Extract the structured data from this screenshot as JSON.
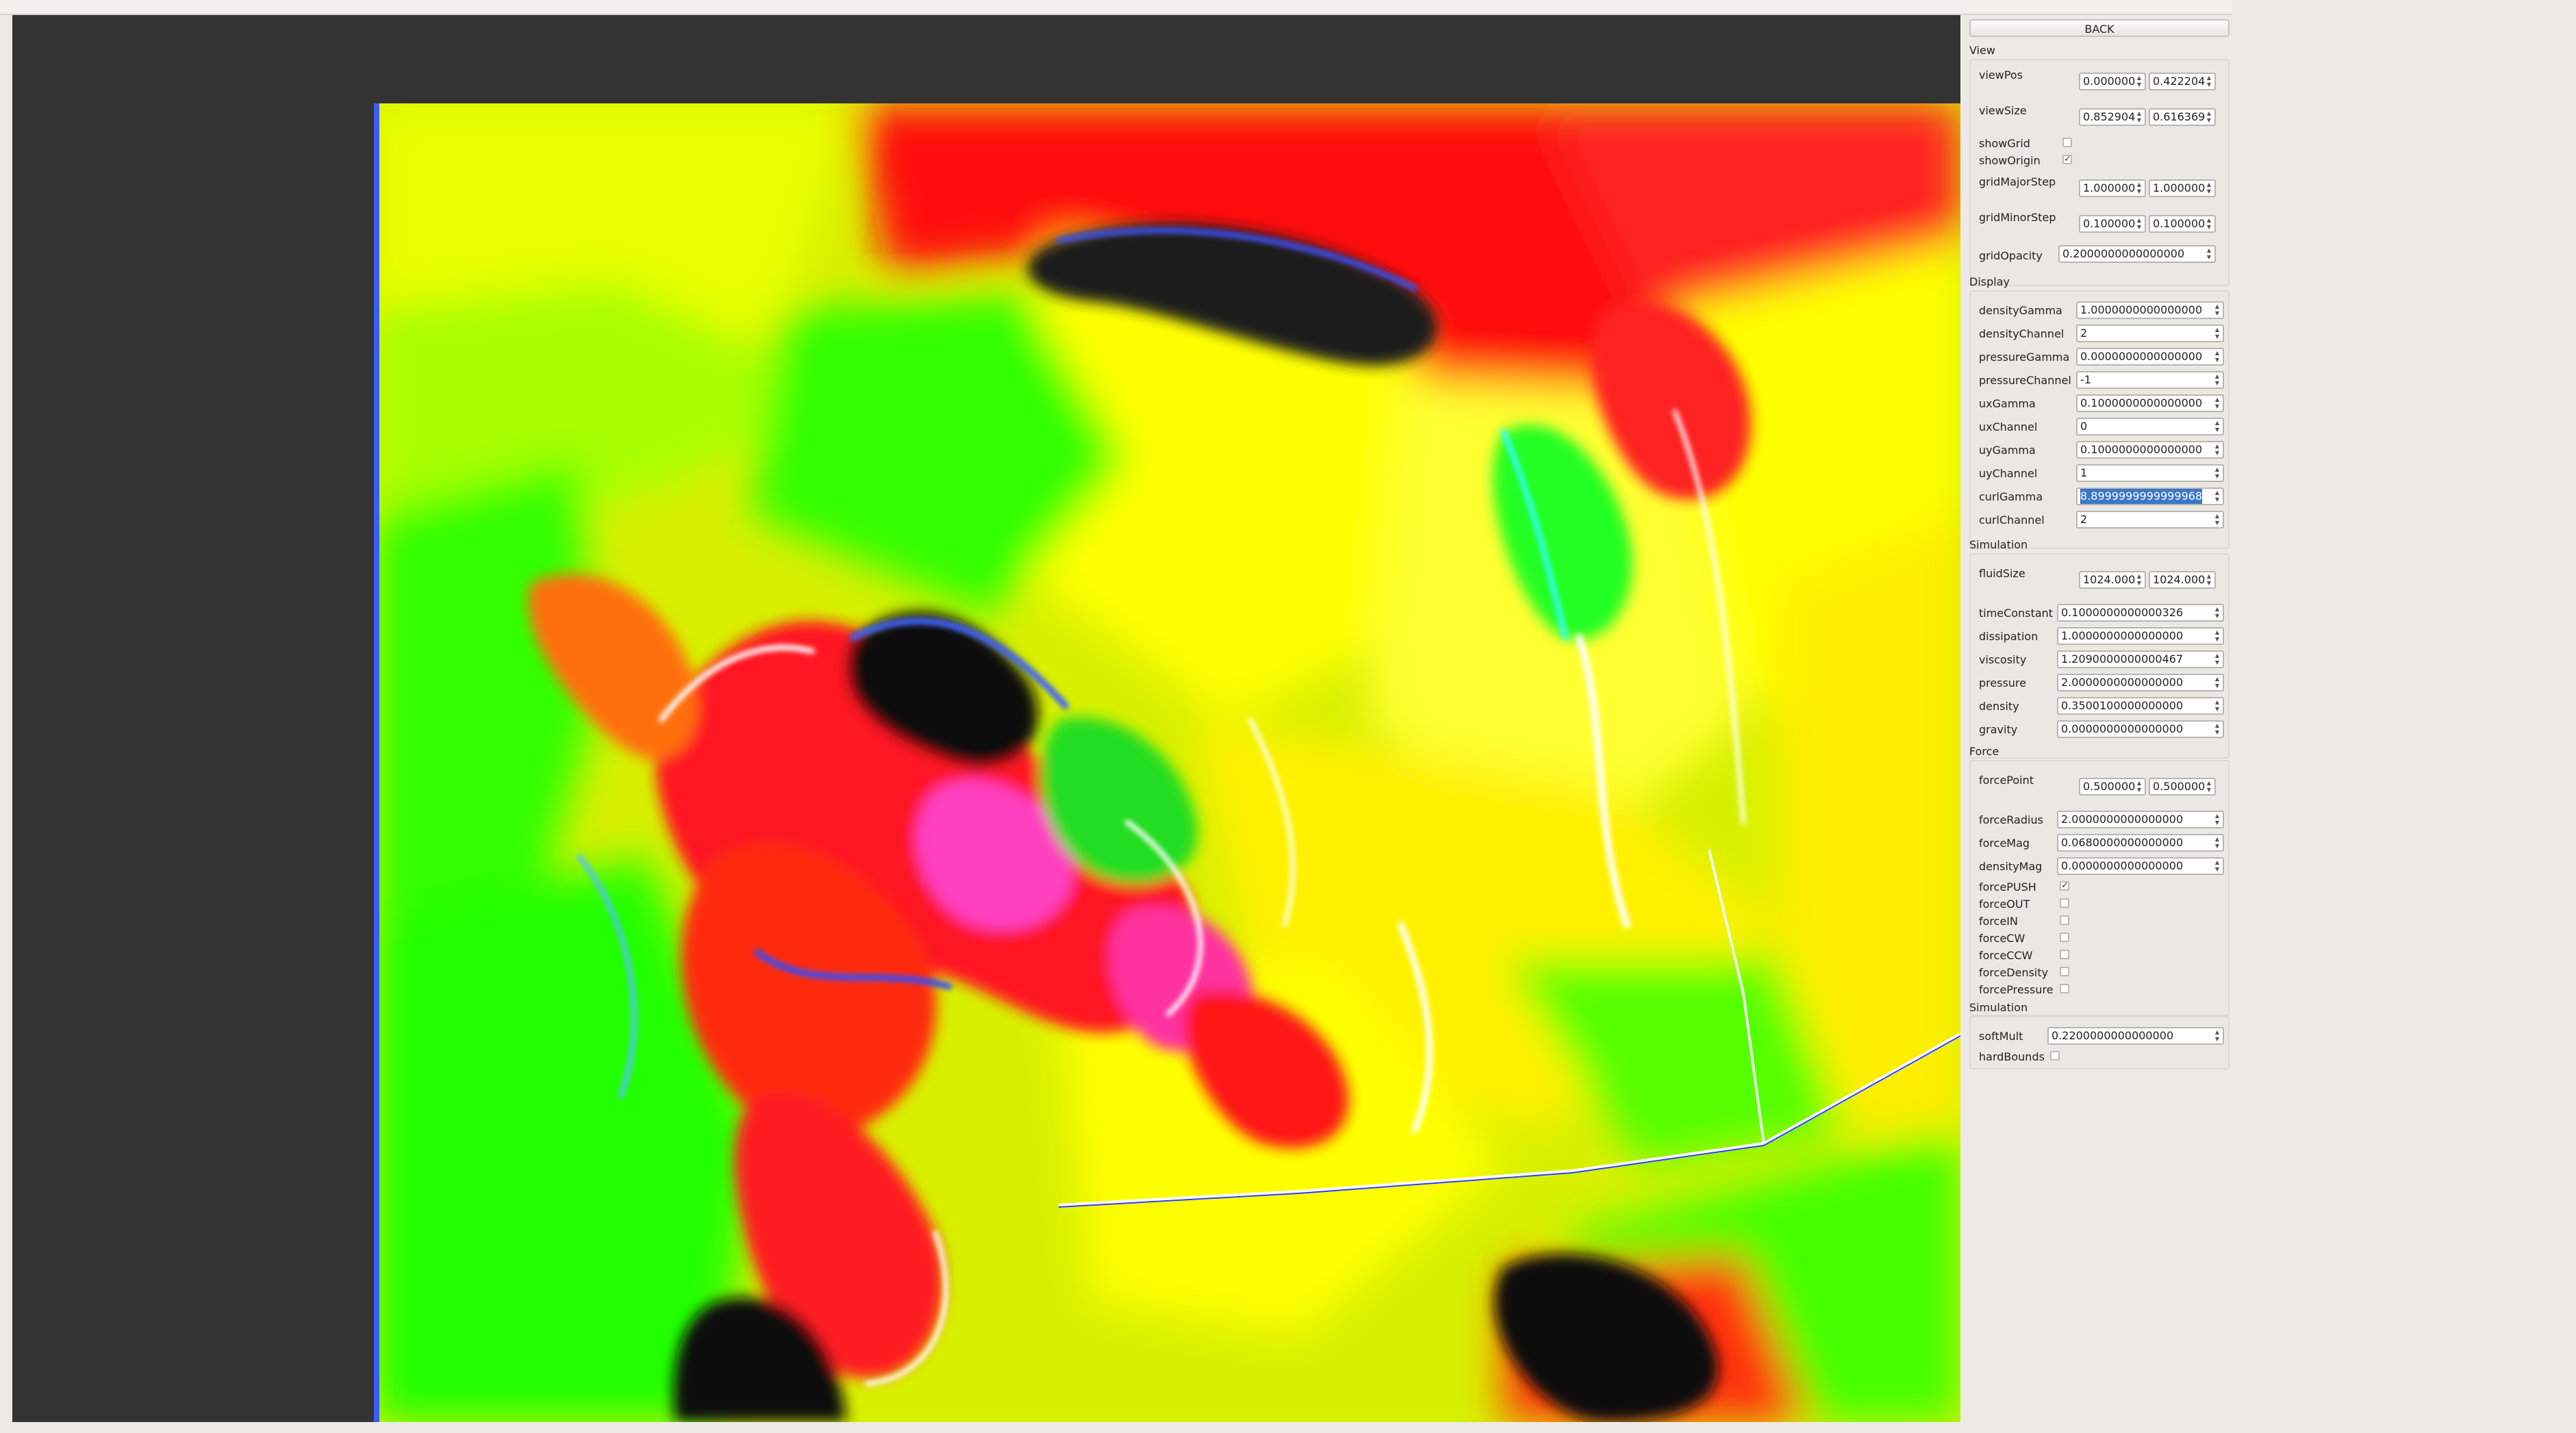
{
  "back_label": "BACK",
  "icons": {
    "spin_arrows": "spin-up-down-icon",
    "checkbox_checked": "check-mark-icon"
  },
  "view": {
    "title": "View",
    "viewPos": {
      "label": "viewPos",
      "x": "0.000000",
      "y": "0.422204"
    },
    "viewSize": {
      "label": "viewSize",
      "x": "0.852904",
      "y": "0.616369"
    },
    "showGrid": {
      "label": "showGrid",
      "checked": false
    },
    "showOrigin": {
      "label": "showOrigin",
      "checked": true
    },
    "gridMajorStep": {
      "label": "gridMajorStep",
      "x": "1.000000",
      "y": "1.000000"
    },
    "gridMinorStep": {
      "label": "gridMinorStep",
      "x": "0.100000",
      "y": "0.100000"
    },
    "gridOpacity": {
      "label": "gridOpacity",
      "value": "0.2000000000000000"
    }
  },
  "display": {
    "title": "Display",
    "densityGamma": {
      "label": "densityGamma",
      "value": "1.0000000000000000"
    },
    "densityChannel": {
      "label": "densityChannel",
      "value": "2"
    },
    "pressureGamma": {
      "label": "pressureGamma",
      "value": "0.0000000000000000"
    },
    "pressureChannel": {
      "label": "pressureChannel",
      "value": "-1"
    },
    "uxGamma": {
      "label": "uxGamma",
      "value": "0.1000000000000000"
    },
    "uxChannel": {
      "label": "uxChannel",
      "value": "0"
    },
    "uyGamma": {
      "label": "uyGamma",
      "value": "0.1000000000000000"
    },
    "uyChannel": {
      "label": "uyChannel",
      "value": "1"
    },
    "curlGamma": {
      "label": "curlGamma",
      "value": "8.8999999999999968"
    },
    "curlChannel": {
      "label": "curlChannel",
      "value": "2"
    }
  },
  "simulation": {
    "title": "Simulation",
    "fluidSize": {
      "label": "fluidSize",
      "x": "1024.000",
      "y": "1024.000"
    },
    "timeConstant": {
      "label": "timeConstant",
      "value": "0.1000000000000326"
    },
    "dissipation": {
      "label": "dissipation",
      "value": "1.0000000000000000"
    },
    "viscosity": {
      "label": "viscosity",
      "value": "1.2090000000000467"
    },
    "pressure": {
      "label": "pressure",
      "value": "2.0000000000000000"
    },
    "density": {
      "label": "density",
      "value": "0.3500100000000000"
    },
    "gravity": {
      "label": "gravity",
      "value": "0.0000000000000000"
    }
  },
  "force": {
    "title": "Force",
    "forcePoint": {
      "label": "forcePoint",
      "x": "0.500000",
      "y": "0.500000"
    },
    "forceRadius": {
      "label": "forceRadius",
      "value": "2.0000000000000000"
    },
    "forceMag": {
      "label": "forceMag",
      "value": "0.0680000000000000"
    },
    "densityMag": {
      "label": "densityMag",
      "value": "0.0000000000000000"
    },
    "forcePUSH": {
      "label": "forcePUSH",
      "checked": true
    },
    "forceOUT": {
      "label": "forceOUT",
      "checked": false
    },
    "forceIN": {
      "label": "forceIN",
      "checked": false
    },
    "forceCW": {
      "label": "forceCW",
      "checked": false
    },
    "forceCCW": {
      "label": "forceCCW",
      "checked": false
    },
    "forceDensity": {
      "label": "forceDensity",
      "checked": false
    },
    "forcePressure": {
      "label": "forcePressure",
      "checked": false
    }
  },
  "simulation2": {
    "title": "Simulation",
    "softMult": {
      "label": "softMult",
      "value": "0.2200000000000000"
    },
    "hardBounds": {
      "label": "hardBounds",
      "checked": false
    }
  }
}
